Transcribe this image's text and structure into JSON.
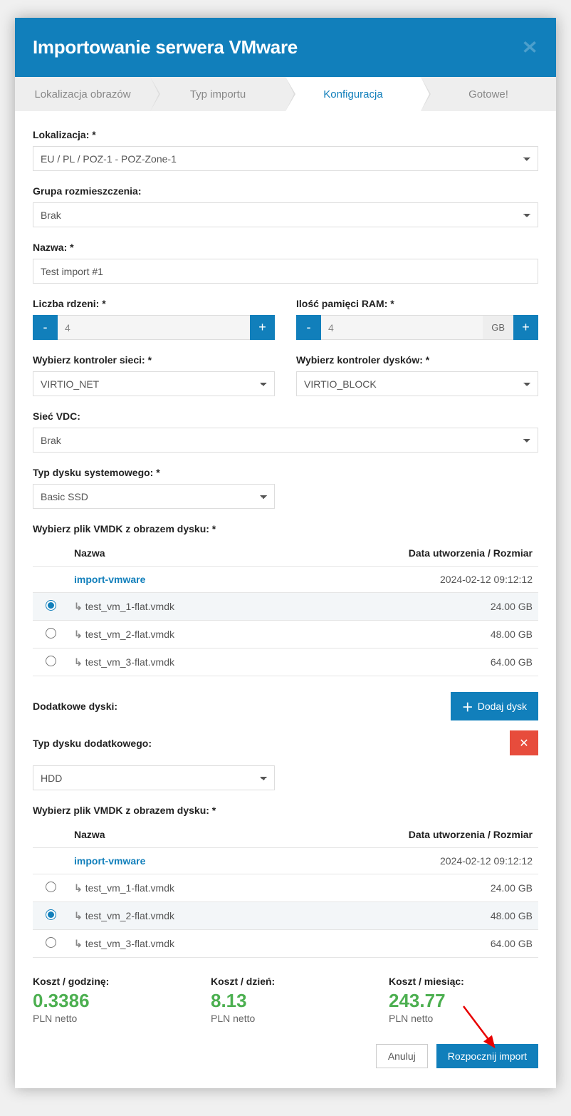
{
  "header": {
    "title": "Importowanie serwera VMware"
  },
  "steps": [
    "Lokalizacja obrazów",
    "Typ importu",
    "Konfiguracja",
    "Gotowe!"
  ],
  "activeStep": 2,
  "form": {
    "lokalizacja_label": "Lokalizacja: *",
    "lokalizacja_value": "EU / PL / POZ-1 - POZ-Zone-1",
    "grupa_label": "Grupa rozmieszczenia:",
    "grupa_value": "Brak",
    "nazwa_label": "Nazwa: *",
    "nazwa_value": "Test import #1",
    "rdzeni_label": "Liczba rdzeni: *",
    "rdzeni_value": "4",
    "ram_label": "Ilość pamięci RAM: *",
    "ram_value": "4",
    "ram_unit": "GB",
    "net_label": "Wybierz kontroler sieci: *",
    "net_value": "VIRTIO_NET",
    "disk_label": "Wybierz kontroler dysków: *",
    "disk_value": "VIRTIO_BLOCK",
    "siec_label": "Sieć VDC:",
    "siec_value": "Brak",
    "sysdisk_label": "Typ dysku systemowego: *",
    "sysdisk_value": "Basic SSD",
    "vmdk_label": "Wybierz plik VMDK z obrazem dysku: *",
    "dodatkowe_label": "Dodatkowe dyski:",
    "dodaj_dysk": "Dodaj dysk",
    "typ_dodatkowego_label": "Typ dysku dodatkowego:",
    "typ_dodatkowego_value": "HDD"
  },
  "table_headers": {
    "col_radio": "",
    "col_name": "Nazwa",
    "col_date": "Data utworzenia / Rozmiar"
  },
  "vmdk1": {
    "folder": {
      "name": "import-vmware",
      "date": "2024-02-12 09:12:12"
    },
    "rows": [
      {
        "name": "test_vm_1-flat.vmdk",
        "size": "24.00 GB",
        "selected": true
      },
      {
        "name": "test_vm_2-flat.vmdk",
        "size": "48.00 GB",
        "selected": false
      },
      {
        "name": "test_vm_3-flat.vmdk",
        "size": "64.00 GB",
        "selected": false
      }
    ]
  },
  "vmdk2": {
    "folder": {
      "name": "import-vmware",
      "date": "2024-02-12 09:12:12"
    },
    "rows": [
      {
        "name": "test_vm_1-flat.vmdk",
        "size": "24.00 GB",
        "selected": false
      },
      {
        "name": "test_vm_2-flat.vmdk",
        "size": "48.00 GB",
        "selected": true
      },
      {
        "name": "test_vm_3-flat.vmdk",
        "size": "64.00 GB",
        "selected": false
      }
    ]
  },
  "costs": {
    "hour_label": "Koszt / godzinę:",
    "hour_value": "0.3386",
    "hour_sub": "PLN netto",
    "day_label": "Koszt / dzień:",
    "day_value": "8.13",
    "day_sub": "PLN netto",
    "month_label": "Koszt / miesiąc:",
    "month_value": "243.77",
    "month_sub": "PLN netto"
  },
  "footer": {
    "cancel": "Anuluj",
    "start": "Rozpocznij import"
  }
}
